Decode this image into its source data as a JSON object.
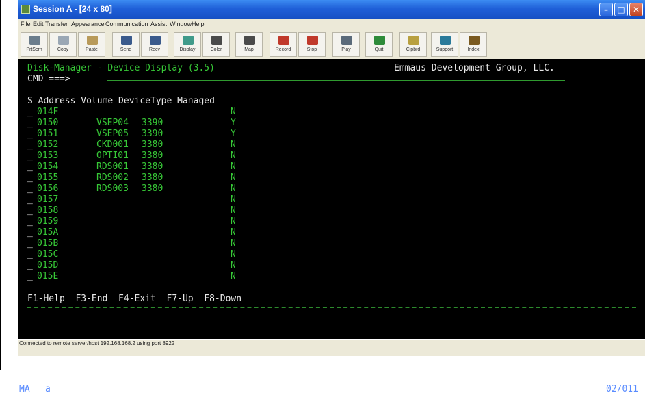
{
  "window": {
    "title": "Session A - [24 x 80]",
    "min_glyph": "–",
    "max_glyph": "□",
    "close_glyph": "✕"
  },
  "menu": [
    "File",
    "Edit",
    "Transfer",
    "Appearance",
    "Communication",
    "Assist",
    "Window",
    "Help"
  ],
  "toolbar": [
    {
      "label": "PrtScrn",
      "icon": "print-screen-icon",
      "color": "#6b7d8c"
    },
    {
      "label": "Copy",
      "icon": "copy-icon",
      "color": "#9aa7b5"
    },
    {
      "label": "Paste",
      "icon": "paste-icon",
      "color": "#b89a5a"
    },
    {
      "label": "Send",
      "icon": "send-icon",
      "color": "#3a5a8c"
    },
    {
      "label": "Recv",
      "icon": "receive-icon",
      "color": "#3a5a8c"
    },
    {
      "label": "Display",
      "icon": "display-icon",
      "color": "#3f9a8a"
    },
    {
      "label": "Color",
      "icon": "color-icon",
      "color": "#4a4a4a"
    },
    {
      "label": "Map",
      "icon": "map-icon",
      "color": "#4a4a4a"
    },
    {
      "label": "Record",
      "icon": "record-icon",
      "color": "#c0392b"
    },
    {
      "label": "Stop",
      "icon": "stop-icon",
      "color": "#c0392b"
    },
    {
      "label": "Play",
      "icon": "play-icon",
      "color": "#5a6a7a"
    },
    {
      "label": "Quit",
      "icon": "quit-icon",
      "color": "#2e8b3a"
    },
    {
      "label": "Clpbrd",
      "icon": "clipboard-icon",
      "color": "#b8a040"
    },
    {
      "label": "Support",
      "icon": "support-icon",
      "color": "#2a7a9a"
    },
    {
      "label": "Index",
      "icon": "index-icon",
      "color": "#7a5a20"
    }
  ],
  "terminal": {
    "screen_title": "Disk-Manager - Device Display (3.5)",
    "company": "Emmaus Development Group, LLC.",
    "cmd_prompt": "CMD ===>",
    "headers": "S Address Volume DeviceType Managed",
    "rows": [
      {
        "sel": "_",
        "address": "014F",
        "volume": "",
        "device_type": "",
        "managed": "N"
      },
      {
        "sel": "_",
        "address": "0150",
        "volume": "VSEP04",
        "device_type": "3390",
        "managed": "Y"
      },
      {
        "sel": "_",
        "address": "0151",
        "volume": "VSEP05",
        "device_type": "3390",
        "managed": "Y"
      },
      {
        "sel": "_",
        "address": "0152",
        "volume": "CKD001",
        "device_type": "3380",
        "managed": "N"
      },
      {
        "sel": "_",
        "address": "0153",
        "volume": "OPTI01",
        "device_type": "3380",
        "managed": "N"
      },
      {
        "sel": "_",
        "address": "0154",
        "volume": "RDS001",
        "device_type": "3380",
        "managed": "N"
      },
      {
        "sel": "_",
        "address": "0155",
        "volume": "RDS002",
        "device_type": "3380",
        "managed": "N"
      },
      {
        "sel": "_",
        "address": "0156",
        "volume": "RDS003",
        "device_type": "3380",
        "managed": "N"
      },
      {
        "sel": "_",
        "address": "0157",
        "volume": "",
        "device_type": "",
        "managed": "N"
      },
      {
        "sel": "_",
        "address": "0158",
        "volume": "",
        "device_type": "",
        "managed": "N"
      },
      {
        "sel": "_",
        "address": "0159",
        "volume": "",
        "device_type": "",
        "managed": "N"
      },
      {
        "sel": "_",
        "address": "015A",
        "volume": "",
        "device_type": "",
        "managed": "N"
      },
      {
        "sel": "_",
        "address": "015B",
        "volume": "",
        "device_type": "",
        "managed": "N"
      },
      {
        "sel": "_",
        "address": "015C",
        "volume": "",
        "device_type": "",
        "managed": "N"
      },
      {
        "sel": "_",
        "address": "015D",
        "volume": "",
        "device_type": "",
        "managed": "N"
      },
      {
        "sel": "_",
        "address": "015E",
        "volume": "",
        "device_type": "",
        "managed": "N"
      }
    ],
    "fkeys": "F1-Help  F3-End  F4-Exit  F7-Up  F8-Down",
    "status_mode": "MA",
    "status_indicator": "a",
    "cursor_pos": "02/011"
  },
  "status": "Connected to remote server/host 192.168.168.2 using port 8922",
  "colors": {
    "terminal_bg": "#000000",
    "terminal_green": "#37c837",
    "terminal_white": "#e8e8e8",
    "titlebar_blue": "#1f5fd8"
  }
}
